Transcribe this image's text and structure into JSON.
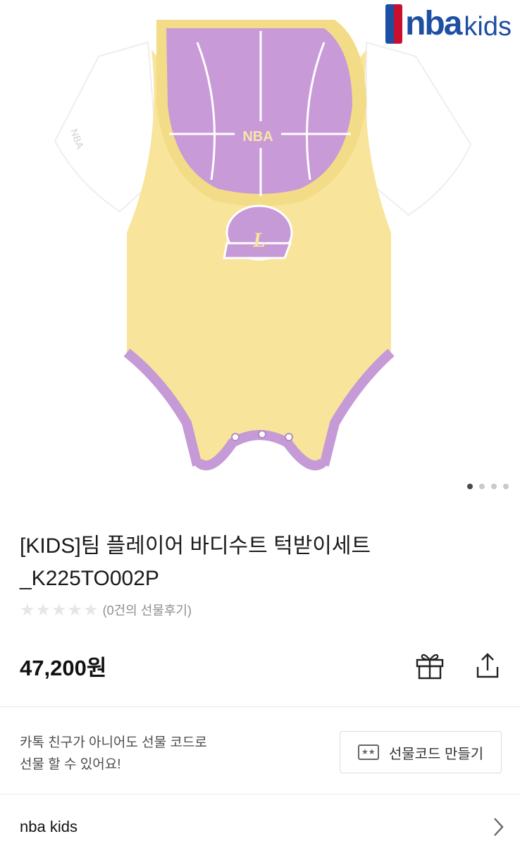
{
  "brand_logo": {
    "nba": "nba",
    "kids": "kids"
  },
  "product_image": {
    "slide_count": 4,
    "active_slide": 1
  },
  "product": {
    "title": "[KIDS]팀 플레이어 바디수트 턱받이세트_K225TO002P",
    "rating_text": "(0건의 선물후기)",
    "stars_filled": 0,
    "stars_total": 5,
    "price": "47,200원"
  },
  "actions": {
    "gift": "gift-icon",
    "share": "share-icon"
  },
  "gift_code": {
    "note_line1": "카톡 친구가 아니어도 선물 코드로",
    "note_line2": "선물 할 수 있어요!",
    "button_label": "선물코드 만들기"
  },
  "brand": {
    "name": "nba kids"
  },
  "colors": {
    "bodysuit_yellow": "#f8e49a",
    "trim_purple": "#c59ad6",
    "bib_purple": "#c99ad8",
    "sleeve_white": "#ffffff"
  }
}
